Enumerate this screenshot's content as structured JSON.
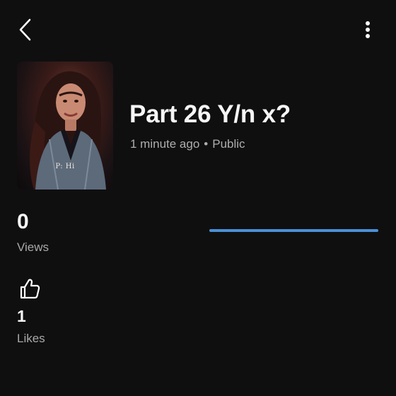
{
  "header": {
    "back_icon": "chevron-left-icon",
    "more_icon": "vertical-dots-icon"
  },
  "story": {
    "title": "Part 26 Y/n x?",
    "time_ago": "1 minute ago",
    "separator": "•",
    "visibility": "Public",
    "thumbnail_caption": "P: Hi"
  },
  "stats": {
    "views": {
      "value": "0",
      "label": "Views",
      "bar_fill_fraction": 1.0,
      "bar_color": "#4a90d9"
    },
    "likes": {
      "icon": "thumbs-up-icon",
      "value": "1",
      "label": "Likes"
    }
  }
}
